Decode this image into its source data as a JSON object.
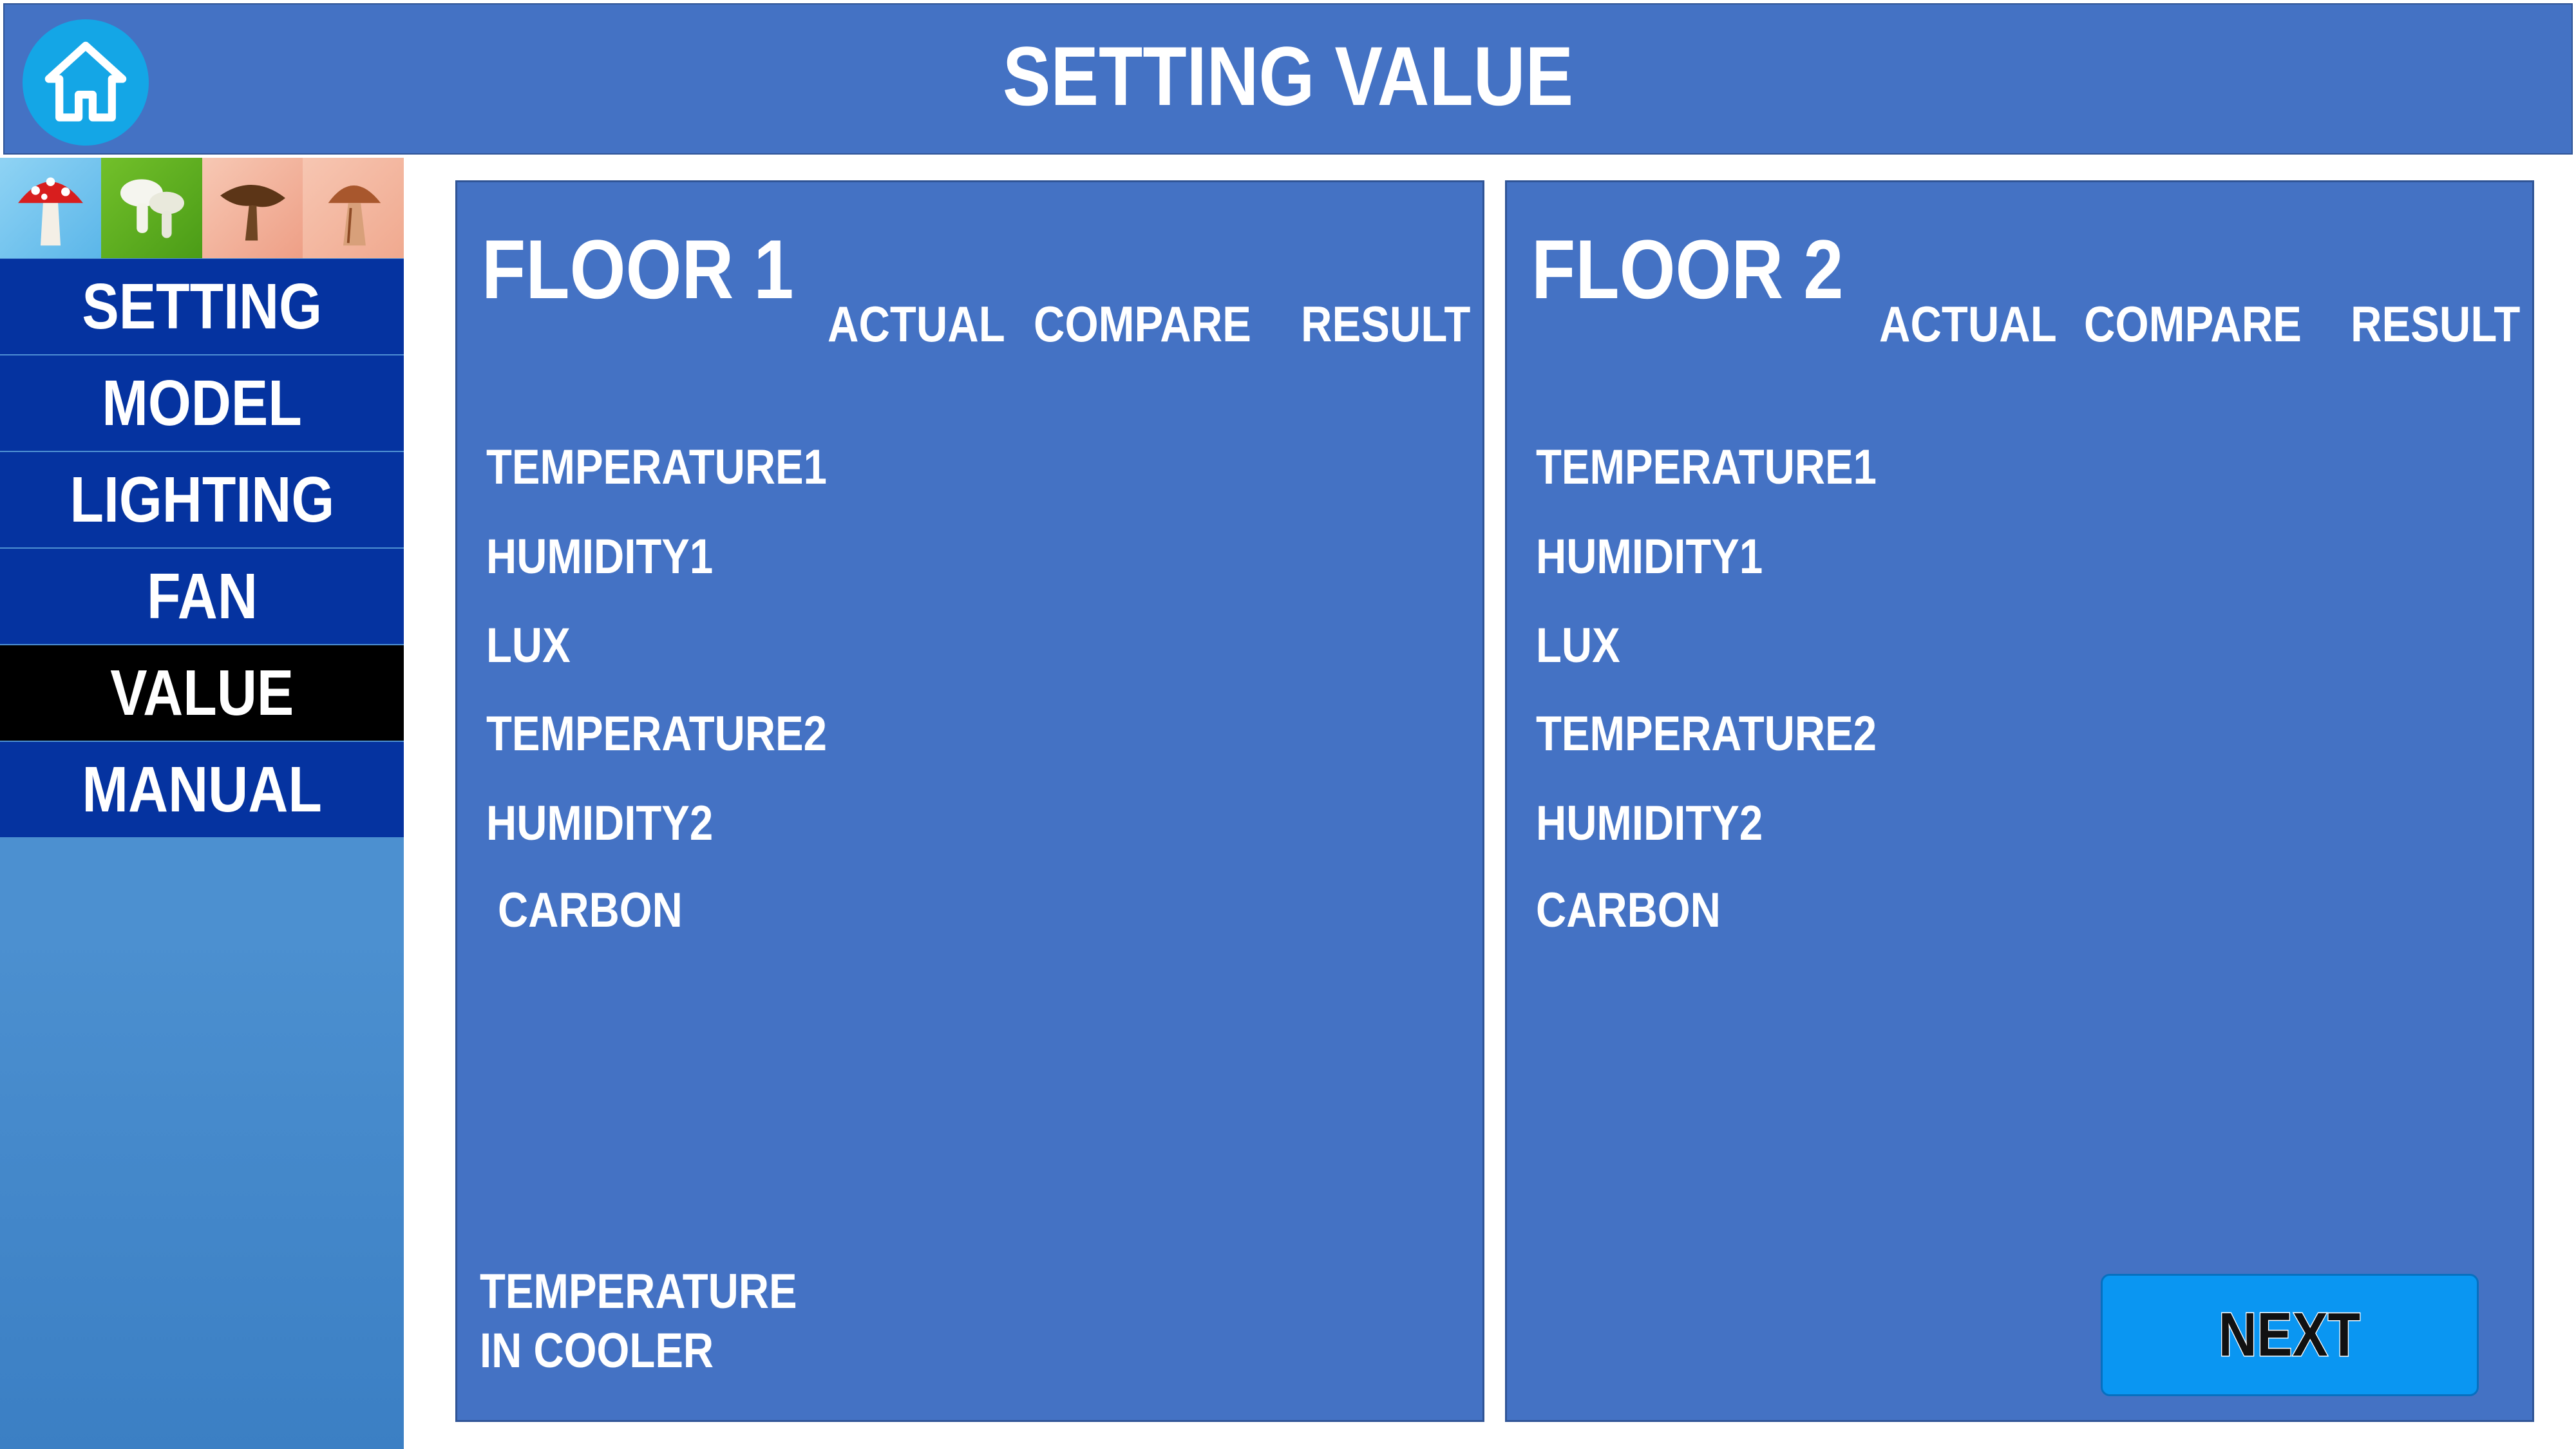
{
  "header": {
    "title": "SETTING VALUE",
    "home_icon": "home-icon"
  },
  "sidebar": {
    "tiles": [
      "red-mushroom-icon",
      "white-mushroom-icon",
      "brown-mushroom-icon",
      "cap-mushroom-icon"
    ],
    "menu": [
      {
        "label": "SETTING",
        "active": false
      },
      {
        "label": "MODEL",
        "active": false
      },
      {
        "label": "LIGHTING",
        "active": false
      },
      {
        "label": "FAN",
        "active": false
      },
      {
        "label": "VALUE",
        "active": true
      },
      {
        "label": "MANUAL",
        "active": false
      }
    ]
  },
  "floors": [
    {
      "title": "FLOOR 1",
      "columns": [
        "ACTUAL",
        "COMPARE",
        "RESULT"
      ],
      "rows": [
        "TEMPERATURE1",
        "HUMIDITY1",
        "LUX",
        "TEMPERATURE2",
        "HUMIDITY2",
        "CARBON"
      ],
      "cooler_label": [
        "TEMPERATURE",
        "IN COOLER"
      ]
    },
    {
      "title": "FLOOR 2",
      "columns": [
        "ACTUAL",
        "COMPARE",
        "RESULT"
      ],
      "rows": [
        "TEMPERATURE1",
        "HUMIDITY1",
        "LUX",
        "TEMPERATURE2",
        "HUMIDITY2",
        "CARBON"
      ]
    }
  ],
  "next_button": {
    "label": "NEXT"
  },
  "colors": {
    "header": "#4472c4",
    "panel": "#4472c4",
    "menu_item": "#0533a0",
    "menu_active": "#000000",
    "home_button": "#14a6e6",
    "next_button": "#0a96f2"
  }
}
